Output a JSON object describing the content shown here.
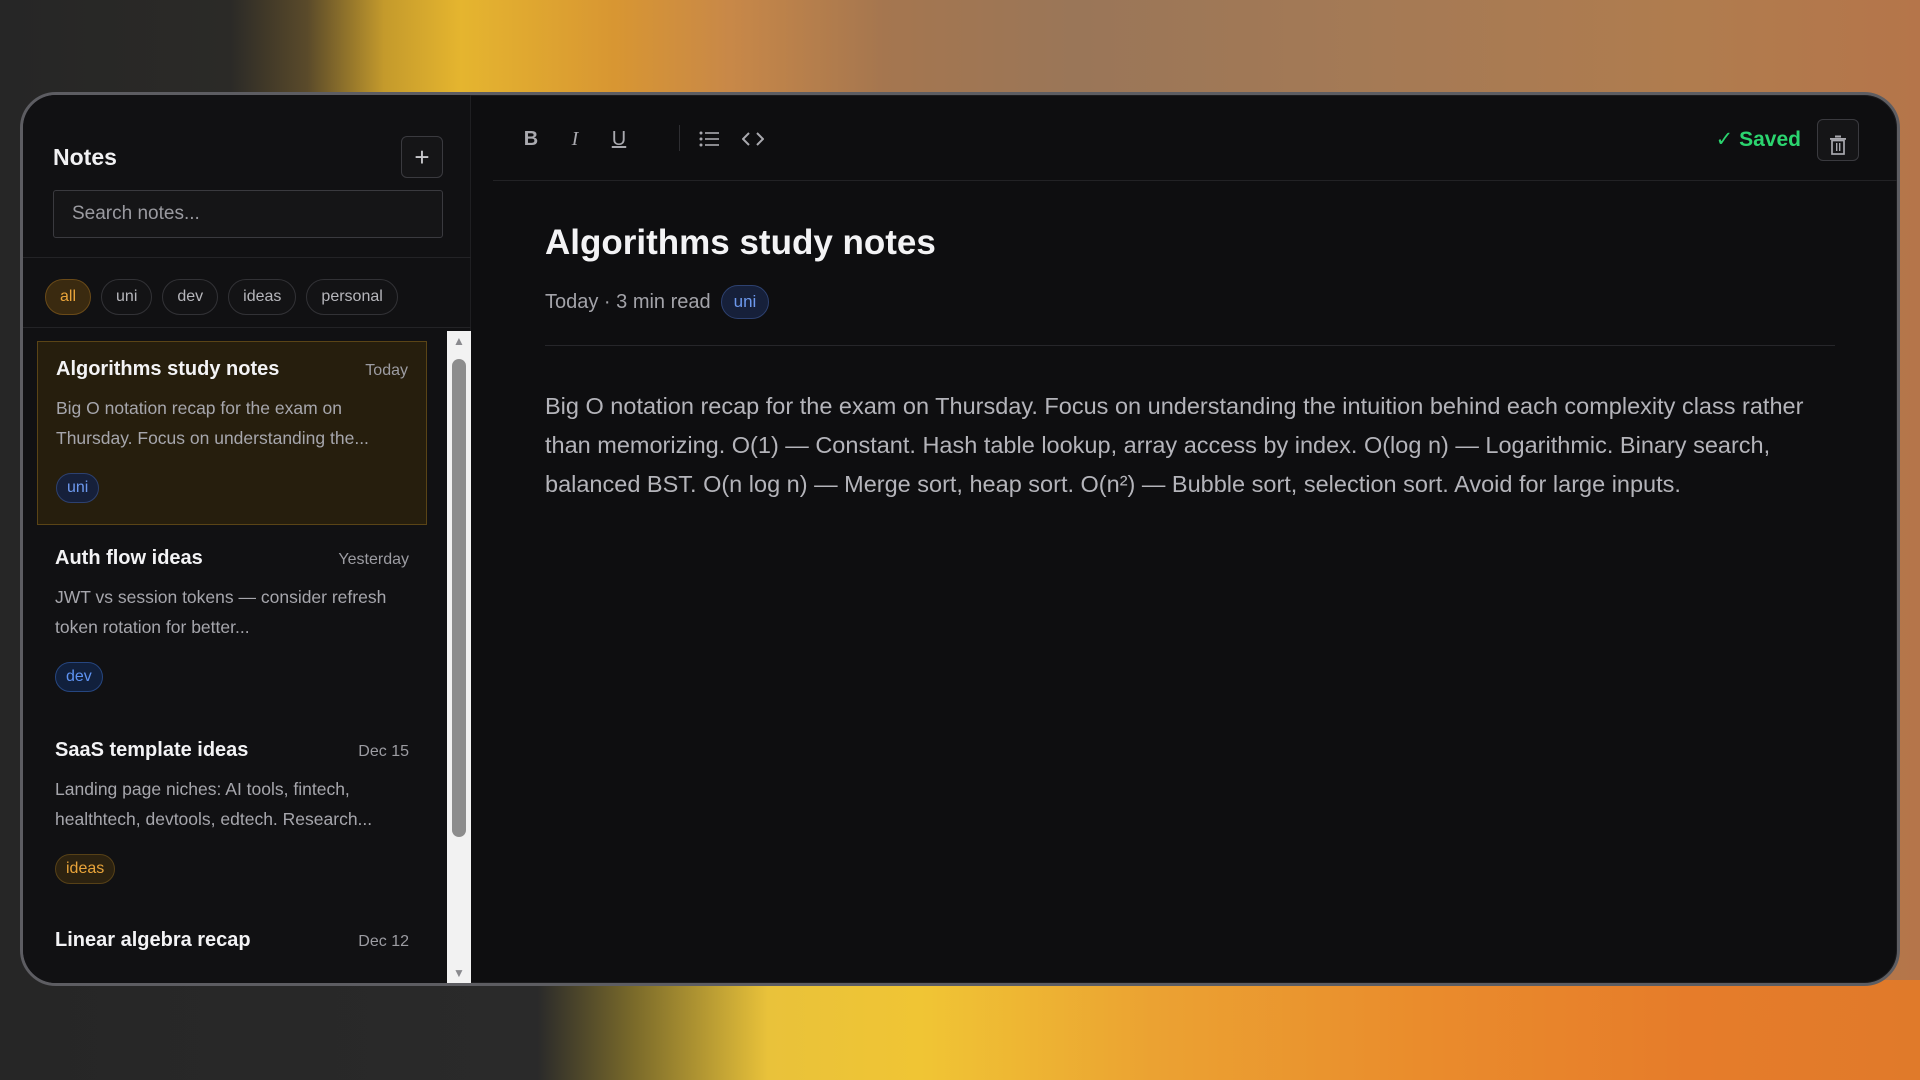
{
  "sidebar": {
    "title": "Notes",
    "add_label": "+",
    "search_placeholder": "Search notes...",
    "filters": [
      "all",
      "uni",
      "dev",
      "ideas",
      "personal"
    ],
    "active_filter": "all",
    "notes": [
      {
        "title": "Algorithms study notes",
        "date": "Today",
        "preview": "Big O notation recap for the exam on Thursday. Focus on understanding the...",
        "tag": "uni"
      },
      {
        "title": "Auth flow ideas",
        "date": "Yesterday",
        "preview": "JWT vs session tokens — consider refresh token rotation for better...",
        "tag": "dev"
      },
      {
        "title": "SaaS template ideas",
        "date": "Dec 15",
        "preview": "Landing page niches: AI tools, fintech, healthtech, devtools, edtech. Research...",
        "tag": "ideas"
      },
      {
        "title": "Linear algebra recap",
        "date": "Dec 12",
        "preview": "",
        "tag": ""
      }
    ]
  },
  "toolbar": {
    "bold": "B",
    "italic": "I",
    "underline": "U",
    "saved_label": "Saved",
    "saved_check": "✓"
  },
  "editor": {
    "title": "Algorithms study notes",
    "meta": "Today · 3 min read",
    "tag": "uni",
    "body": "Big O notation recap for the exam on Thursday. Focus on understanding the intuition behind each complexity class rather than memorizing. O(1) — Constant. Hash table lookup, array access by index. O(log n) — Logarithmic. Binary search, balanced BST. O(n log n) — Merge sort, heap sort. O(n²) — Bubble sort, selection sort. Avoid for large inputs."
  },
  "colors": {
    "accent": "#e9a43a",
    "saved": "#2bd46f",
    "tag_uni": "#6d99ee",
    "tag_dev": "#5e93f2",
    "tag_ideas": "#e9a43a"
  },
  "icons": {
    "add": "plus-icon",
    "bullet_list": "list-icon",
    "code": "code-icon",
    "trash": "trash-icon",
    "scroll_up": "scroll-up-arrow",
    "scroll_down": "scroll-down-arrow"
  }
}
